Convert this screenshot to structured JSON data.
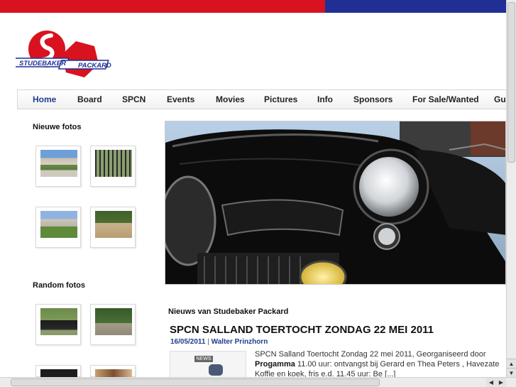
{
  "colors": {
    "red": "#d8131f",
    "blue": "#1f2f94",
    "nav_active": "#1e3d8f"
  },
  "logo": {
    "line1": "STUDEBAKER",
    "line2": "PACKARD",
    "icon": "studebaker-packard-logo"
  },
  "nav": {
    "items": [
      "Home",
      "Board",
      "SPCN",
      "Events",
      "Movies",
      "Pictures",
      "Info",
      "Sponsors",
      "For Sale/Wanted",
      "Gu"
    ],
    "active": "Home"
  },
  "sidebar": {
    "new_photos_heading": "Nieuwe fotos",
    "random_photos_heading": "Random fotos"
  },
  "news": {
    "heading": "Nieuws van Studebaker Packard",
    "article": {
      "title": "SPCN SALLAND TOERTOCHT ZONDAG 22 MEI 2011",
      "date": "16/05/2011",
      "separator": "|",
      "author": "Walter Prinzhorn",
      "thumb_label": "NEWS",
      "text_intro": "SPCN Salland Toertocht Zondag 22 mei 2011, Georganiseerd door",
      "text_bold": "Progamma",
      "text_body": " 11.00 uur: ontvangst bij Gerard en Thea Peters , Havezate",
      "text_more": "Koffie en koek, fris e.d. 11.45 uur: Be [...]"
    }
  },
  "scrollbars": {
    "up": "▲",
    "down": "▼",
    "left": "◀",
    "right": "▶"
  }
}
